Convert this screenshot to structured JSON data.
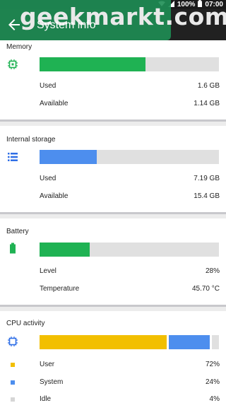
{
  "status_bar": {
    "battery": "100%",
    "time": "07:00"
  },
  "app_bar": {
    "title": "System info",
    "watermark": "geekmarkt.com"
  },
  "colors": {
    "green": "#1fb253",
    "blue": "#4d8eee",
    "yellow": "#f2bf00",
    "track": "#e0e0e0"
  },
  "memory": {
    "title": "Memory",
    "icon": "chip-icon",
    "fill_fraction": 0.59,
    "used_label": "Used",
    "used_value": "1.6 GB",
    "available_label": "Available",
    "available_value": "1.14 GB"
  },
  "storage": {
    "title": "Internal storage",
    "icon": "list-icon",
    "fill_fraction": 0.32,
    "used_label": "Used",
    "used_value": "7.19 GB",
    "available_label": "Available",
    "available_value": "15.4 GB"
  },
  "battery": {
    "title": "Battery",
    "icon": "battery-icon",
    "fill_fraction": 0.28,
    "level_label": "Level",
    "level_value": "28%",
    "temp_label": "Temperature",
    "temp_value": "45.70 °C"
  },
  "cpu": {
    "title": "CPU activity",
    "icon": "cpu-icon",
    "user_fraction": 0.72,
    "system_fraction": 0.24,
    "idle_fraction": 0.04,
    "user_label": "User",
    "user_value": "72%",
    "system_label": "System",
    "system_value": "24%",
    "idle_label": "Idle",
    "idle_value": "4%"
  }
}
